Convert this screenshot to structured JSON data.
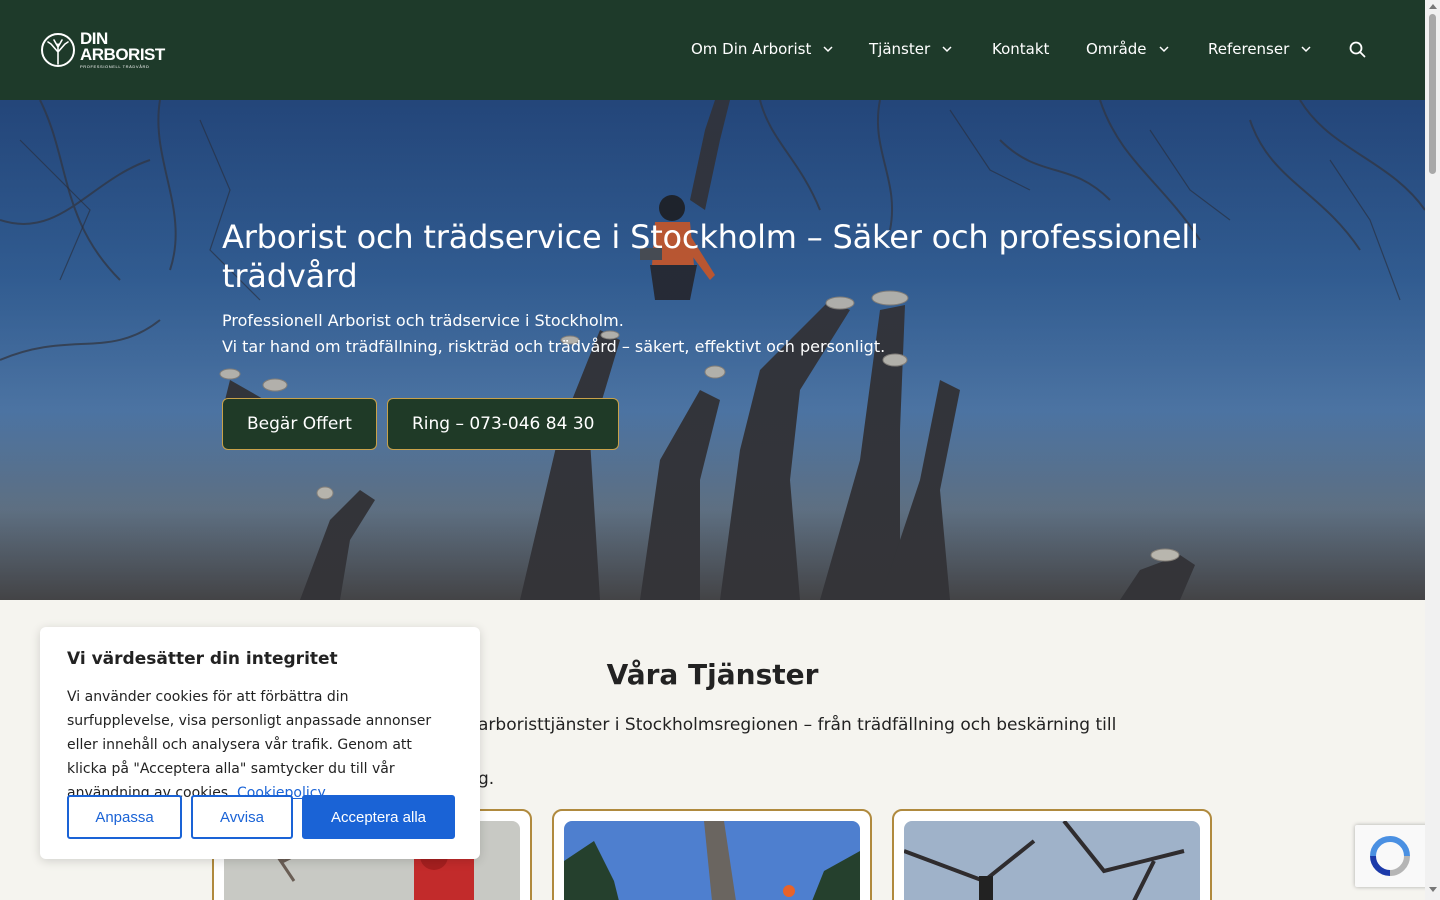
{
  "header": {
    "logo": {
      "line1": "DIN",
      "line2": "ARBORIST",
      "tagline": "PROFESSIONELL TRÄDVÅRD"
    },
    "nav": [
      {
        "label": "Om Din Arborist",
        "has_dropdown": true
      },
      {
        "label": "Tjänster",
        "has_dropdown": true
      },
      {
        "label": "Kontakt",
        "has_dropdown": false
      },
      {
        "label": "Område",
        "has_dropdown": true
      },
      {
        "label": "Referenser",
        "has_dropdown": true
      }
    ]
  },
  "hero": {
    "title": "Arborist och trädservice i Stockholm – Säker och professionell trädvård",
    "subtitle_line1": "Professionell Arborist och trädservice i Stockholm.",
    "subtitle_line2": "Vi tar hand om trädfällning, riskträd och trädvård – säkert, effektivt och personligt.",
    "cta_quote": "Begär Offert",
    "cta_call": "Ring – 073-046 84 30"
  },
  "services": {
    "title": "Våra Tjänster",
    "description_line1": "arboristtjänster i Stockholmsregionen – från trädfällning och beskärning till stubbfräsning,",
    "description_line2": "g."
  },
  "cookie": {
    "title": "Vi värdesätter din integritet",
    "text": "Vi använder cookies för att förbättra din surfupplevelse, visa personligt anpassade annonser eller innehåll och analysera vår trafik. Genom att klicka på \"Acceptera alla\" samtycker du till vår användning av cookies.",
    "policy_link": "Cookiepolicy",
    "btn_customize": "Anpassa",
    "btn_reject": "Avvisa",
    "btn_accept": "Acceptera alla"
  },
  "colors": {
    "header_bg": "#1e3a2a",
    "button_dark": "#1f3a27",
    "gold_border": "#c9a24a",
    "cookie_blue": "#1a63d6",
    "card_border": "#b08a3e"
  }
}
